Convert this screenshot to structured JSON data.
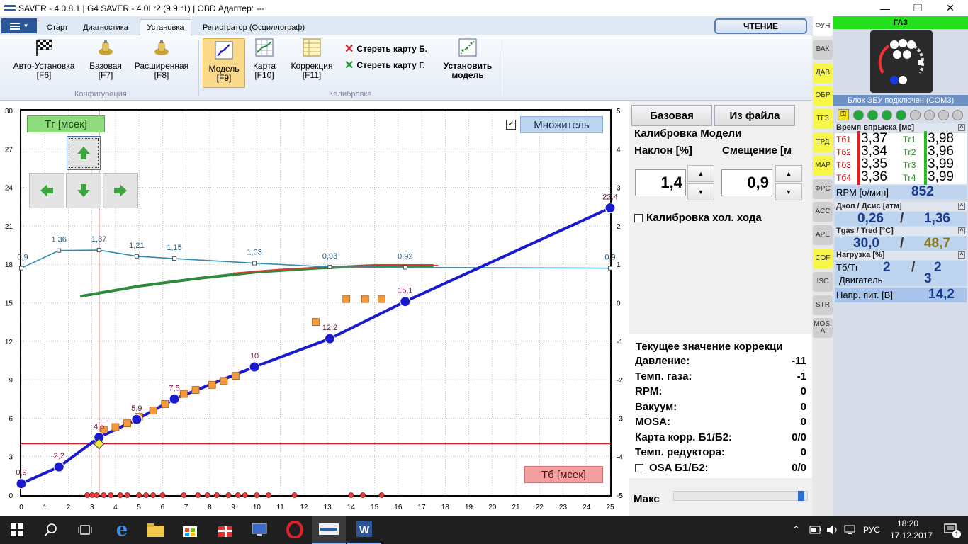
{
  "window": {
    "title": "SAVER - 4.0.8.1  |  G4 SAVER - 4.0I r2 (9.9 r1)  |  OBD Адаптер: ---",
    "minimize": "—",
    "maximize": "❐",
    "close": "✕"
  },
  "ribbon": {
    "tabs": [
      "Старт",
      "Диагностика",
      "Установка",
      "Регистратор (Осциллограф)"
    ],
    "active_tab": "Установка",
    "read_button": "ЧТЕНИЕ",
    "groups": {
      "config": {
        "label": "Конфигурация",
        "buttons": [
          {
            "label": "Авто-Установка",
            "key": "[F6]"
          },
          {
            "label": "Базовая",
            "key": "[F7]"
          },
          {
            "label": "Расширенная",
            "key": "[F8]"
          }
        ]
      },
      "calibration": {
        "label": "Калибровка",
        "buttons": [
          {
            "label": "Модель",
            "key": "[F9]"
          },
          {
            "label": "Карта",
            "key": "[F10]"
          },
          {
            "label": "Коррекция",
            "key": "[F11]"
          }
        ],
        "erase_b": "Стереть карту Б.",
        "erase_g": "Стереть карту Г.",
        "set_model_1": "Установить",
        "set_model_2": "модель"
      }
    }
  },
  "chart_overlay": {
    "tg_label": "Тг [мсек]",
    "tb_label": "Тб [мсек]",
    "multiplier_label": "Множитель",
    "multiplier_checked": true
  },
  "chart_data": {
    "type": "line",
    "xlim": [
      0,
      25
    ],
    "ylim": [
      0,
      30
    ],
    "y2lim": [
      -5,
      5
    ],
    "x_ticks": [
      0,
      1,
      2,
      3,
      4,
      5,
      6,
      7,
      8,
      9,
      10,
      11,
      12,
      13,
      14,
      15,
      16,
      17,
      18,
      19,
      20,
      21,
      22,
      23,
      24,
      25
    ],
    "y_ticks": [
      0,
      3,
      6,
      9,
      12,
      15,
      18,
      21,
      24,
      27,
      30
    ],
    "y2_ticks": [
      -5,
      -4,
      -3,
      -2,
      -1,
      0,
      1,
      2,
      3,
      4,
      5
    ],
    "grid": true,
    "cursor": {
      "x": 3.3,
      "y": 4.0
    },
    "model_line": {
      "color": "#1a1acf",
      "points": [
        [
          0,
          0.9
        ],
        [
          1.6,
          2.2
        ],
        [
          3.3,
          4.5
        ],
        [
          4.9,
          5.9
        ],
        [
          6.5,
          7.5
        ],
        [
          9.9,
          10
        ],
        [
          13.1,
          12.2
        ],
        [
          16.3,
          15.1
        ],
        [
          25,
          22.4
        ]
      ],
      "labels": [
        "0,9",
        "2,2",
        "4,5",
        "5,9",
        "7,5",
        "10",
        "12,2",
        "15,1",
        "22,4"
      ]
    },
    "multiplier_line": {
      "color": "#2e8fb0",
      "points": [
        [
          0,
          0.9
        ],
        [
          1.6,
          1.36
        ],
        [
          3.3,
          1.37
        ],
        [
          4.9,
          1.21
        ],
        [
          6.5,
          1.15
        ],
        [
          9.9,
          1.03
        ],
        [
          13.1,
          0.93
        ],
        [
          16.3,
          0.92
        ],
        [
          25,
          0.9
        ]
      ],
      "labels": [
        "0,9",
        "1,36",
        "1,37",
        "1,21",
        "1,15",
        "1,03",
        "0,93",
        "0,92",
        "0,9"
      ]
    },
    "green_curve": {
      "color": "#2f8a3d",
      "points": [
        [
          2.5,
          15.5
        ],
        [
          5,
          16.3
        ],
        [
          7.5,
          16.9
        ],
        [
          10,
          17.4
        ],
        [
          12.5,
          17.7
        ],
        [
          15,
          17.9
        ],
        [
          17.5,
          17.9
        ]
      ]
    },
    "red_curve": {
      "color": "#d23c2a",
      "points": [
        [
          9,
          17.3
        ],
        [
          11,
          17.6
        ],
        [
          13,
          17.8
        ],
        [
          15,
          17.9
        ],
        [
          17.7,
          17.9
        ]
      ]
    },
    "orange_points": [
      [
        3.5,
        5.1
      ],
      [
        4,
        5.3
      ],
      [
        4.5,
        5.6
      ],
      [
        5,
        6.1
      ],
      [
        5.6,
        6.6
      ],
      [
        6.1,
        7.1
      ],
      [
        6.9,
        7.9
      ],
      [
        7.4,
        8.2
      ],
      [
        8.1,
        8.6
      ],
      [
        8.6,
        8.9
      ],
      [
        9.1,
        9.3
      ],
      [
        12.5,
        13.5
      ],
      [
        13.8,
        15.3
      ],
      [
        14.6,
        15.3
      ],
      [
        15.3,
        15.3
      ]
    ],
    "red_dots_x": [
      2.8,
      3.0,
      3.2,
      3.5,
      3.8,
      4.2,
      4.5,
      5.0,
      5.3,
      5.6,
      6.0,
      6.9,
      7.5,
      7.9,
      8.3,
      8.8,
      9.2,
      9.5,
      10.0,
      10.5,
      11.6,
      14.0,
      14.5,
      15.3
    ]
  },
  "mid_panel": {
    "btn_base": "Базовая",
    "btn_file": "Из файла",
    "title": "Калибровка Модели",
    "slope_label": "Наклон [%]",
    "offset_label": "Смещение [м",
    "slope_value": "1,4",
    "offset_value": "0,9",
    "idle_calib": "Калибровка хол. хода",
    "corr_title": "Текущее значение коррекци",
    "corr_rows": [
      {
        "label": "Давление:",
        "value": "-11"
      },
      {
        "label": "Темп. газа:",
        "value": "-1"
      },
      {
        "label": "RPM:",
        "value": "0"
      },
      {
        "label": "Вакуум:",
        "value": "0"
      },
      {
        "label": "MOSA:",
        "value": "0"
      },
      {
        "label": "Карта корр. Б1/Б2:",
        "value": "0/0"
      },
      {
        "label": "Темп. редуктора:",
        "value": "0"
      },
      {
        "label": "OSA Б1/Б2:",
        "value": "0/0"
      }
    ],
    "max_label": "Макс"
  },
  "func_strip": [
    "ФУН",
    "ВАК",
    "ДАВ",
    "ОБР",
    "ТГЗ",
    "ТРД",
    "МАР",
    "ФРС",
    "АСС",
    "АРЕ",
    "СОF",
    "ISC",
    "STR",
    "MOS. A"
  ],
  "right_panel": {
    "gas_label": "ГАЗ",
    "ecu_status": "Блок ЭБУ подключен (COM3)",
    "inj_title": "Время впрыска [мс]",
    "inj": [
      {
        "b_label": "Тб1",
        "b_val": "3,37",
        "g_label": "Тг1",
        "g_val": "3,98"
      },
      {
        "b_label": "Тб2",
        "b_val": "3,34",
        "g_label": "Тг2",
        "g_val": "3,96"
      },
      {
        "b_label": "Тб3",
        "b_val": "3,35",
        "g_label": "Тг3",
        "g_val": "3,99"
      },
      {
        "b_label": "Тб4",
        "b_val": "3,36",
        "g_label": "Тг4",
        "g_val": "3,99"
      }
    ],
    "rpm_label": "RPM [о/мин]",
    "rpm_value": "852",
    "pressure_title": "Дкол / Дсис [атм]",
    "pressure_kol": "0,26",
    "pressure_sep": "/",
    "pressure_sys": "1,36",
    "temp_title": "Tgas / Tred [°С]",
    "temp_gas": "30,0",
    "temp_sep": "/",
    "temp_red": "48,7",
    "load_title": "Нагрузка [%]",
    "load_tbtg_label": "Тб/Тг",
    "load_tb": "2",
    "load_sep": "/",
    "load_tg": "2",
    "load_engine_label": "Двигатель",
    "load_engine": "3",
    "volt_label": "Напр. пит. [В]",
    "volt_value": "14,2"
  },
  "taskbar": {
    "lang": "РУС",
    "time": "18:20",
    "date": "17.12.2017",
    "notif_count": "1"
  }
}
